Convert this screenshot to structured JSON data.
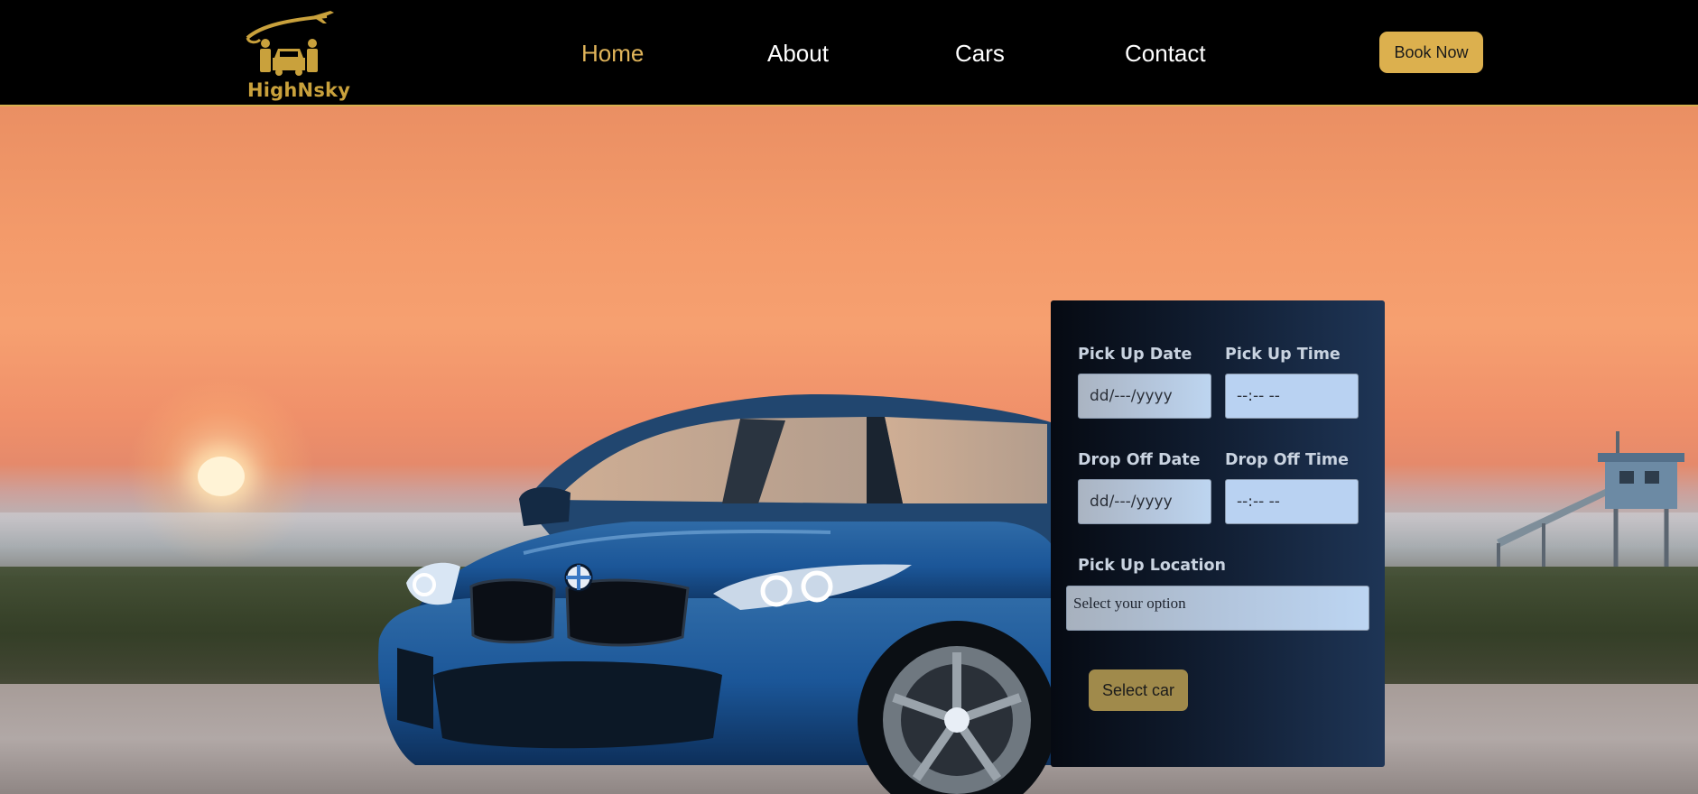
{
  "brand": {
    "name": "HighNsky",
    "logo_icon": "car-plane-people-logo"
  },
  "nav": {
    "items": [
      {
        "label": "Home",
        "active": true
      },
      {
        "label": "About",
        "active": false
      },
      {
        "label": "Cars",
        "active": false
      },
      {
        "label": "Contact",
        "active": false
      }
    ],
    "cta_label": "Book Now"
  },
  "booking": {
    "pickup_date_label": "Pick Up Date",
    "pickup_date_value": "dd/---/yyyy",
    "pickup_time_label": "Pick Up Time",
    "pickup_time_value": "--:-- --",
    "dropoff_date_label": "Drop Off Date",
    "dropoff_date_value": "dd/---/yyyy",
    "dropoff_time_label": "Drop Off Time",
    "dropoff_time_value": "--:-- --",
    "location_label": "Pick Up Location",
    "location_placeholder": "Select your option",
    "submit_label": "Select car"
  },
  "colors": {
    "accent_gold": "#dcb04e",
    "active_nav": "#e0b45a",
    "panel_dark": "#0f1a2c",
    "panel_blue": "#1e3556",
    "car_blue": "#1e5f9e"
  }
}
